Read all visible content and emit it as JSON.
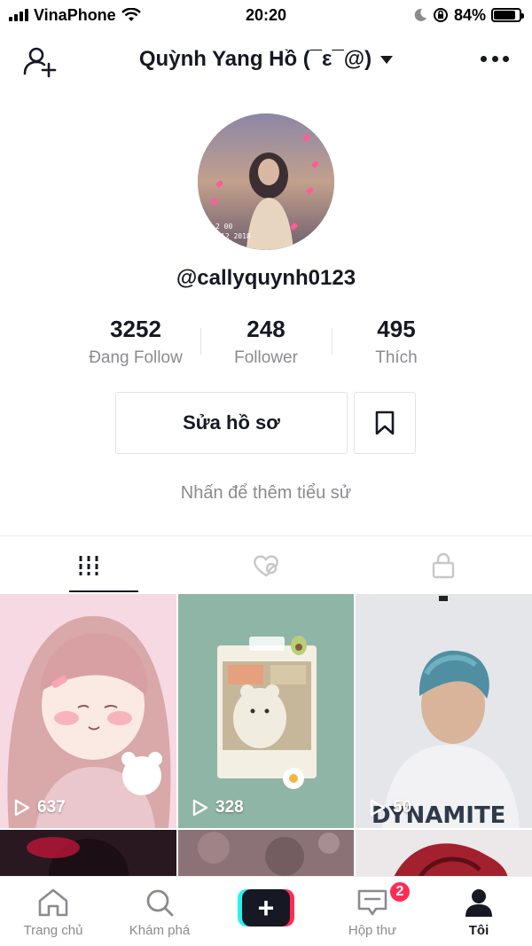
{
  "status_bar": {
    "carrier": "VinaPhone",
    "time": "20:20",
    "battery_percent": "84%",
    "battery_level": 0.84
  },
  "header": {
    "title": "Quỳnh Yang Hồ (¯ε¯@)",
    "add_friend_icon": "person-plus-icon",
    "menu_icon": "more-horizontal-icon"
  },
  "profile": {
    "username": "@callyquynh0123",
    "avatar_overlay_text": [
      "2 00",
      "12 2018"
    ]
  },
  "stats": [
    {
      "value": "3252",
      "label": "Đang Follow"
    },
    {
      "value": "248",
      "label": "Follower"
    },
    {
      "value": "495",
      "label": "Thích"
    }
  ],
  "actions": {
    "edit_profile": "Sửa hồ sơ",
    "bookmark_icon": "bookmark-icon"
  },
  "bio_placeholder": "Nhấn để thêm tiểu sử",
  "tabs": [
    {
      "name": "videos",
      "icon": "grid-icon",
      "active": true
    },
    {
      "name": "liked",
      "icon": "hidden-heart-icon",
      "active": false
    },
    {
      "name": "private",
      "icon": "lock-icon",
      "active": false
    }
  ],
  "videos": [
    {
      "views": "637"
    },
    {
      "views": "328"
    },
    {
      "views": "50",
      "caption_art": "DYNAMITE"
    },
    {
      "views": ""
    },
    {
      "views": ""
    },
    {
      "views": ""
    }
  ],
  "bottom_nav": [
    {
      "label": "Trang chủ",
      "icon": "home-icon"
    },
    {
      "label": "Khám phá",
      "icon": "search-icon"
    },
    {
      "label": "",
      "icon": "plus-icon"
    },
    {
      "label": "Hộp thư",
      "icon": "inbox-icon",
      "badge": "2"
    },
    {
      "label": "Tôi",
      "icon": "profile-icon",
      "active": true
    }
  ],
  "colors": {
    "primary_text": "#161823",
    "secondary_text": "#8a8b91",
    "accent_red": "#fe2c55",
    "accent_cyan": "#25f4ee",
    "border": "#e3e3e4"
  }
}
